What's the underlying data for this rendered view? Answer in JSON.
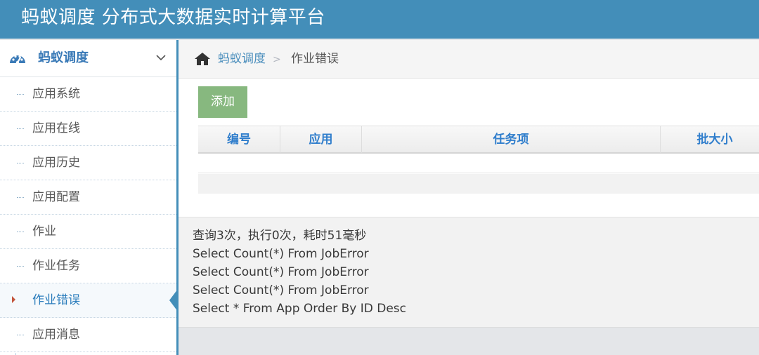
{
  "app": {
    "title": "蚂蚁调度 分布式大数据实时计算平台"
  },
  "sidebar": {
    "section_title": "蚂蚁调度",
    "items": [
      {
        "label": "应用系统",
        "active": false
      },
      {
        "label": "应用在线",
        "active": false
      },
      {
        "label": "应用历史",
        "active": false
      },
      {
        "label": "应用配置",
        "active": false
      },
      {
        "label": "作业",
        "active": false
      },
      {
        "label": "作业任务",
        "active": false
      },
      {
        "label": "作业错误",
        "active": true
      },
      {
        "label": "应用消息",
        "active": false
      }
    ]
  },
  "breadcrumb": {
    "root": "蚂蚁调度",
    "separator": ">",
    "current": "作业错误"
  },
  "toolbar": {
    "add_label": "添加"
  },
  "table": {
    "columns": [
      "编号",
      "应用",
      "任务项",
      "批大小"
    ]
  },
  "sql_log": {
    "summary": "查询3次，执行0次，耗时51毫秒",
    "lines": [
      "Select Count(*) From JobError",
      "Select Count(*) From JobError",
      "Select Count(*) From JobError",
      "Select * From App Order By ID Desc"
    ]
  },
  "colors": {
    "brand": "#438eb9",
    "add_button": "#87b87f",
    "header_text": "#307ecc"
  },
  "icons": {
    "dashboard": "dashboard-icon",
    "home": "home-icon",
    "collapse": "chevron-down-icon"
  }
}
